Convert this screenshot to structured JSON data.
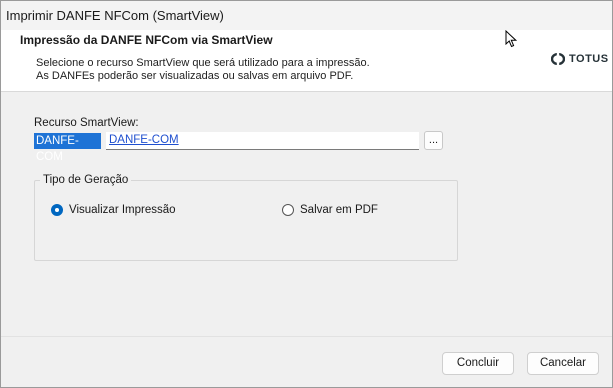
{
  "window": {
    "title": "Imprimir DANFE NFCom (SmartView)"
  },
  "header": {
    "title": "Impressão da DANFE NFCom via SmartView",
    "line1": "Selecione o recurso SmartView que será utilizado para a impressão.",
    "line2": "As DANFEs poderão ser visualizadas ou salvas em arquivo PDF.",
    "logo_text": "TOTUS"
  },
  "resource": {
    "label": "Recurso SmartView:",
    "code": "DANFE-COM",
    "description": "DANFE-COM",
    "lookup_label": "..."
  },
  "generation": {
    "legend": "Tipo de Geração",
    "options": [
      {
        "label": "Visualizar Impressão",
        "checked": true
      },
      {
        "label": "Salvar em PDF",
        "checked": false
      }
    ]
  },
  "buttons": {
    "confirm": "Concluir",
    "cancel": "Cancelar"
  },
  "colors": {
    "selection": "#1e73d6",
    "radio_checked": "#0067c0",
    "link": "#1f4fcf"
  }
}
